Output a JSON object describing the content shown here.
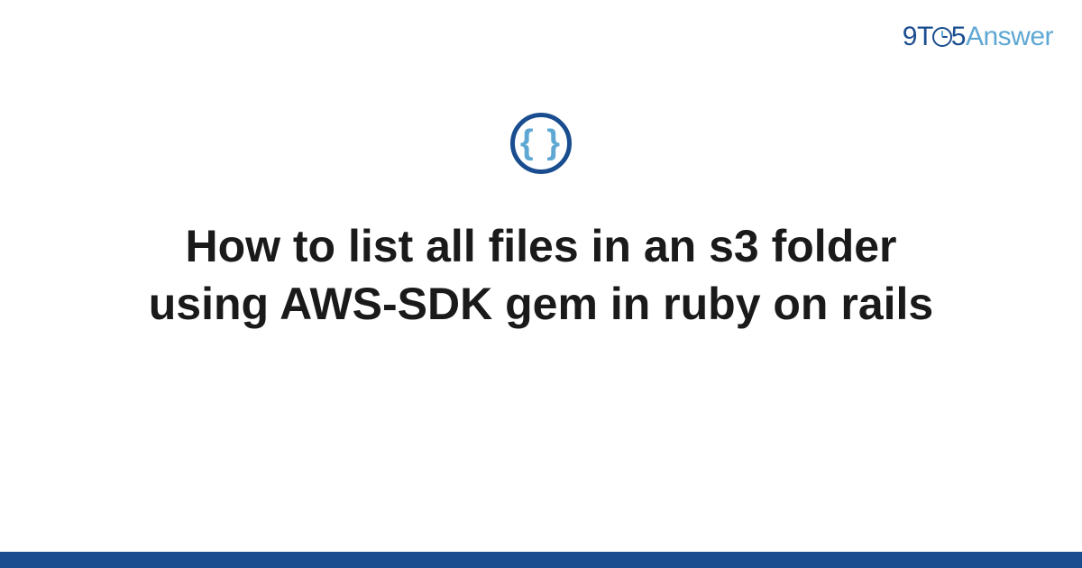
{
  "brand": {
    "nine": "9",
    "t": "T",
    "five": "5",
    "answer": "Answer"
  },
  "icon": {
    "braces": "{ }"
  },
  "title": "How to list all files in an s3 folder using AWS-SDK gem in ruby on rails"
}
